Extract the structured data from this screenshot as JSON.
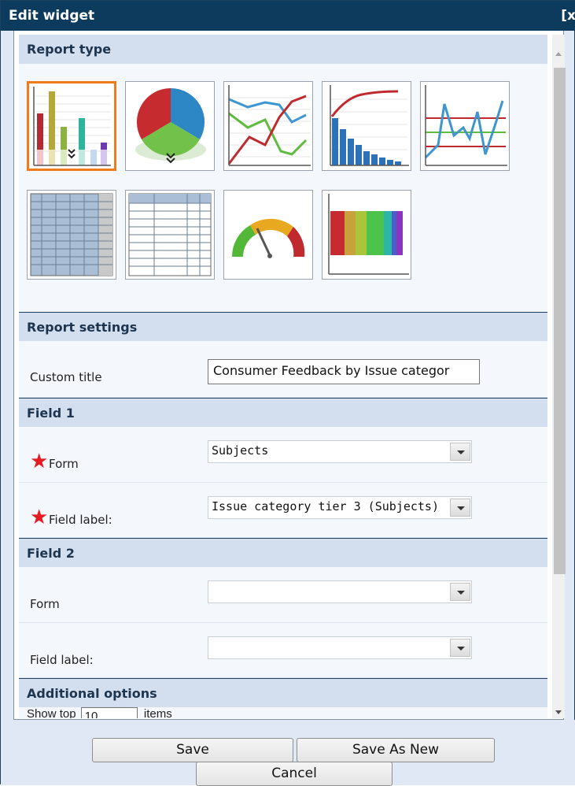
{
  "window": {
    "title": "Edit widget",
    "close_label": "[x"
  },
  "sections": {
    "report_type": "Report type",
    "report_settings": "Report settings",
    "field1": "Field 1",
    "field2": "Field 2",
    "additional": "Additional options"
  },
  "report_types": [
    {
      "name": "bar-chart",
      "selected": true
    },
    {
      "name": "pie-chart",
      "selected": false
    },
    {
      "name": "line-chart",
      "selected": false
    },
    {
      "name": "pareto-chart",
      "selected": false
    },
    {
      "name": "control-chart",
      "selected": false
    },
    {
      "name": "grid-table",
      "selected": false
    },
    {
      "name": "plain-table",
      "selected": false
    },
    {
      "name": "gauge",
      "selected": false
    },
    {
      "name": "color-bar",
      "selected": false
    }
  ],
  "settings": {
    "custom_title_label": "Custom title",
    "custom_title_value": "Consumer Feedback by Issue categor"
  },
  "field1": {
    "form_label": "Form",
    "form_value": "Subjects",
    "field_label": "Field label:",
    "field_value": "Issue category tier 3 (Subjects)"
  },
  "field2": {
    "form_label": "Form",
    "form_value": "",
    "field_label": "Field label:",
    "field_value": ""
  },
  "additional": {
    "show_top_label": "Show top",
    "show_top_value": "10",
    "items_label": "items"
  },
  "buttons": {
    "save": "Save",
    "save_as_new": "Save As New",
    "cancel": "Cancel"
  },
  "required_mark": "★",
  "colors": {
    "titlebar": "#0d3b5e",
    "section_header": "#d3deee",
    "selected_border": "#f07b1a",
    "required": "#e41b23"
  }
}
